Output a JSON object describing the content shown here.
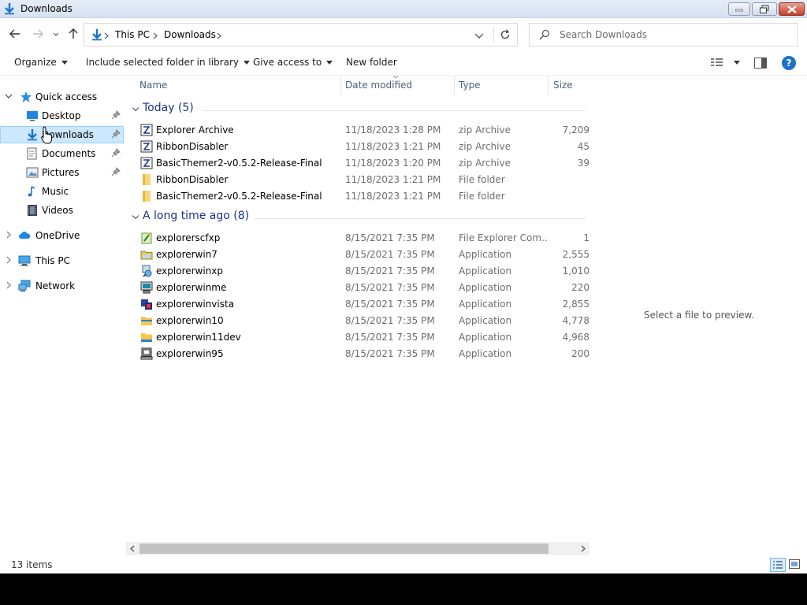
{
  "window": {
    "title": "Downloads"
  },
  "address": {
    "crumbs": [
      "This PC",
      "Downloads"
    ],
    "search_placeholder": "Search Downloads"
  },
  "commands": {
    "organize": "Organize",
    "include_library": "Include selected folder in library",
    "give_access": "Give access to",
    "new_folder": "New folder"
  },
  "nav": {
    "quick_access": "Quick access",
    "desktop": "Desktop",
    "downloads": "Downloads",
    "documents": "Documents",
    "pictures": "Pictures",
    "music": "Music",
    "videos": "Videos",
    "onedrive": "OneDrive",
    "this_pc": "This PC",
    "network": "Network"
  },
  "columns": {
    "name": "Name",
    "date": "Date modified",
    "type": "Type",
    "size": "Size"
  },
  "groups": {
    "today": {
      "title": "Today (5)",
      "rows": [
        {
          "name": "Explorer Archive",
          "date": "11/18/2023 1:28 PM",
          "type": "zip Archive",
          "size": "7,209",
          "icon": "zip-icon"
        },
        {
          "name": "RibbonDisabler",
          "date": "11/18/2023 1:21 PM",
          "type": "zip Archive",
          "size": "45",
          "icon": "zip-icon"
        },
        {
          "name": "BasicThemer2-v0.5.2-Release-Final",
          "date": "11/18/2023 1:20 PM",
          "type": "zip Archive",
          "size": "39",
          "icon": "zip-icon"
        },
        {
          "name": "RibbonDisabler",
          "date": "11/18/2023 1:21 PM",
          "type": "File folder",
          "size": "",
          "icon": "folder-icon"
        },
        {
          "name": "BasicThemer2-v0.5.2-Release-Final",
          "date": "11/18/2023 1:21 PM",
          "type": "File folder",
          "size": "",
          "icon": "folder-icon"
        }
      ]
    },
    "older": {
      "title": "A long time ago (8)",
      "rows": [
        {
          "name": "explorerscfxp",
          "date": "8/15/2021 7:35 PM",
          "type": "File Explorer Com...",
          "size": "1",
          "icon": "scf-icon"
        },
        {
          "name": "explorerwin7",
          "date": "8/15/2021 7:35 PM",
          "type": "Application",
          "size": "2,555",
          "icon": "app-icon"
        },
        {
          "name": "explorerwinxp",
          "date": "8/15/2021 7:35 PM",
          "type": "Application",
          "size": "1,010",
          "icon": "app-icon"
        },
        {
          "name": "explorerwinme",
          "date": "8/15/2021 7:35 PM",
          "type": "Application",
          "size": "220",
          "icon": "app-icon"
        },
        {
          "name": "explorerwinvista",
          "date": "8/15/2021 7:35 PM",
          "type": "Application",
          "size": "2,855",
          "icon": "app-icon"
        },
        {
          "name": "explorerwin10",
          "date": "8/15/2021 7:35 PM",
          "type": "Application",
          "size": "4,778",
          "icon": "app-icon"
        },
        {
          "name": "explorerwin11dev",
          "date": "8/15/2021 7:35 PM",
          "type": "Application",
          "size": "4,968",
          "icon": "app-icon"
        },
        {
          "name": "explorerwin95",
          "date": "8/15/2021 7:35 PM",
          "type": "Application",
          "size": "200",
          "icon": "app-icon"
        }
      ]
    }
  },
  "preview": {
    "text": "Select a file to preview."
  },
  "status": {
    "count": "13 items"
  },
  "colors": {
    "accent": "#1e73c8",
    "selection": "#cce8ff",
    "group_title": "#1e3287"
  }
}
